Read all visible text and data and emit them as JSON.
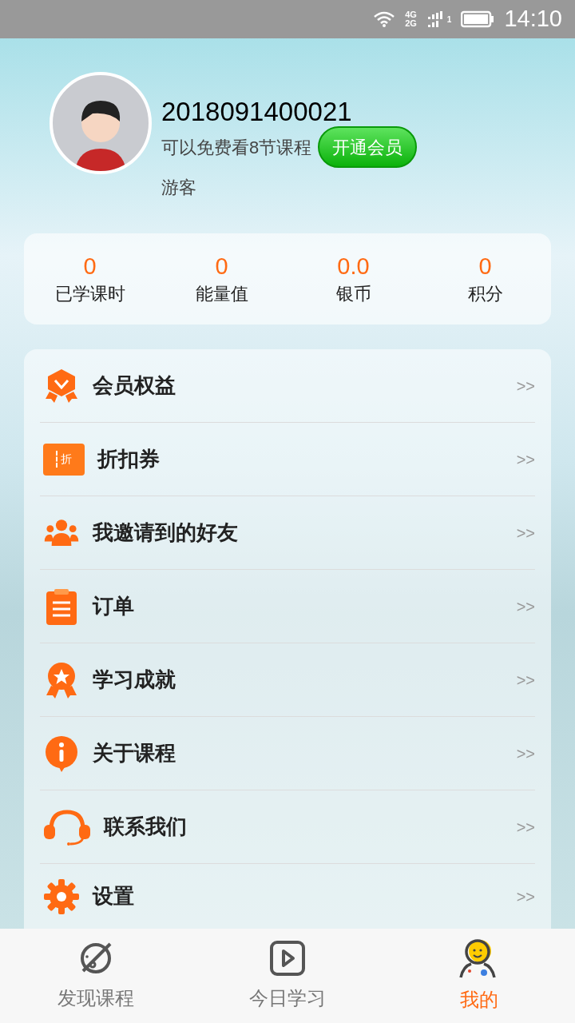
{
  "status_bar": {
    "network_top": "4G",
    "network_bottom": "2G",
    "sim": "1",
    "time": "14:10"
  },
  "profile": {
    "user_id": "2018091400021",
    "free_note": "可以免费看8节课程",
    "vip_button": "开通会员",
    "role": "游客"
  },
  "stats": [
    {
      "value": "0",
      "label": "已学课时"
    },
    {
      "value": "0",
      "label": "能量值"
    },
    {
      "value": "0.0",
      "label": "银币"
    },
    {
      "value": "0",
      "label": "积分"
    }
  ],
  "menu": [
    {
      "kind": "medal",
      "label": "会员权益",
      "arrow": ">>"
    },
    {
      "kind": "coupon",
      "icon_label": "折",
      "label": "折扣券",
      "arrow": ">>"
    },
    {
      "kind": "people",
      "label": "我邀请到的好友",
      "arrow": ">>"
    },
    {
      "kind": "clipboard",
      "label": "订单",
      "arrow": ">>"
    },
    {
      "kind": "award",
      "label": "学习成就",
      "arrow": ">>"
    },
    {
      "kind": "info",
      "label": "关于课程",
      "arrow": ">>"
    },
    {
      "kind": "headset",
      "label": "联系我们",
      "arrow": ">>"
    },
    {
      "kind": "gear",
      "label": "设置",
      "arrow": ">>"
    }
  ],
  "tab_bar": [
    {
      "kind": "discover",
      "label": "发现课程",
      "selected": false
    },
    {
      "kind": "today",
      "label": "今日学习",
      "selected": false
    },
    {
      "kind": "me",
      "label": "我的",
      "selected": true
    }
  ]
}
